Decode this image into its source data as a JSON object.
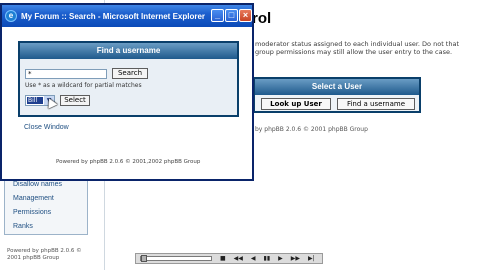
{
  "background_page": {
    "title": "rol",
    "description": "moderator status assigned to each individual user. Do not that group permissions may still allow the user entry to the case.",
    "select_user": {
      "header": "Select a User",
      "lookup_button": "Look up User",
      "find_button": "Find a username"
    },
    "powered_by": "by phpBB 2.0.6 © 2001 phpBB Group",
    "left_nav": {
      "items": [
        "Disallow names",
        "Management",
        "Permissions",
        "Ranks"
      ],
      "powered_by": "Powered by phpBB 2.0.6 © 2001 phpBB Group"
    }
  },
  "popup": {
    "title": "My Forum :: Search - Microsoft Internet Explorer",
    "ie_icon_glyph": "e",
    "controls": {
      "minimize": "_",
      "maximize": "□",
      "close": "×"
    },
    "find_box": {
      "header": "Find a username",
      "search_value": "*",
      "search_button": "Search",
      "hint": "Use * as a wildcard for partial matches",
      "select_value": "Bill",
      "select_button": "Select"
    },
    "close_link": "Close Window",
    "powered_by": "Powered by phpBB 2.0.6 © 2001,2002 phpBB Group"
  },
  "media_controls": {
    "buttons": [
      "■",
      "◀◀",
      "◀",
      "▮▮",
      "▶",
      "▶▶",
      "▶|"
    ]
  },
  "colors": {
    "titlebar": "#1c5fcd",
    "panel_header": "#1f5a8c",
    "link": "#1f4f82"
  }
}
